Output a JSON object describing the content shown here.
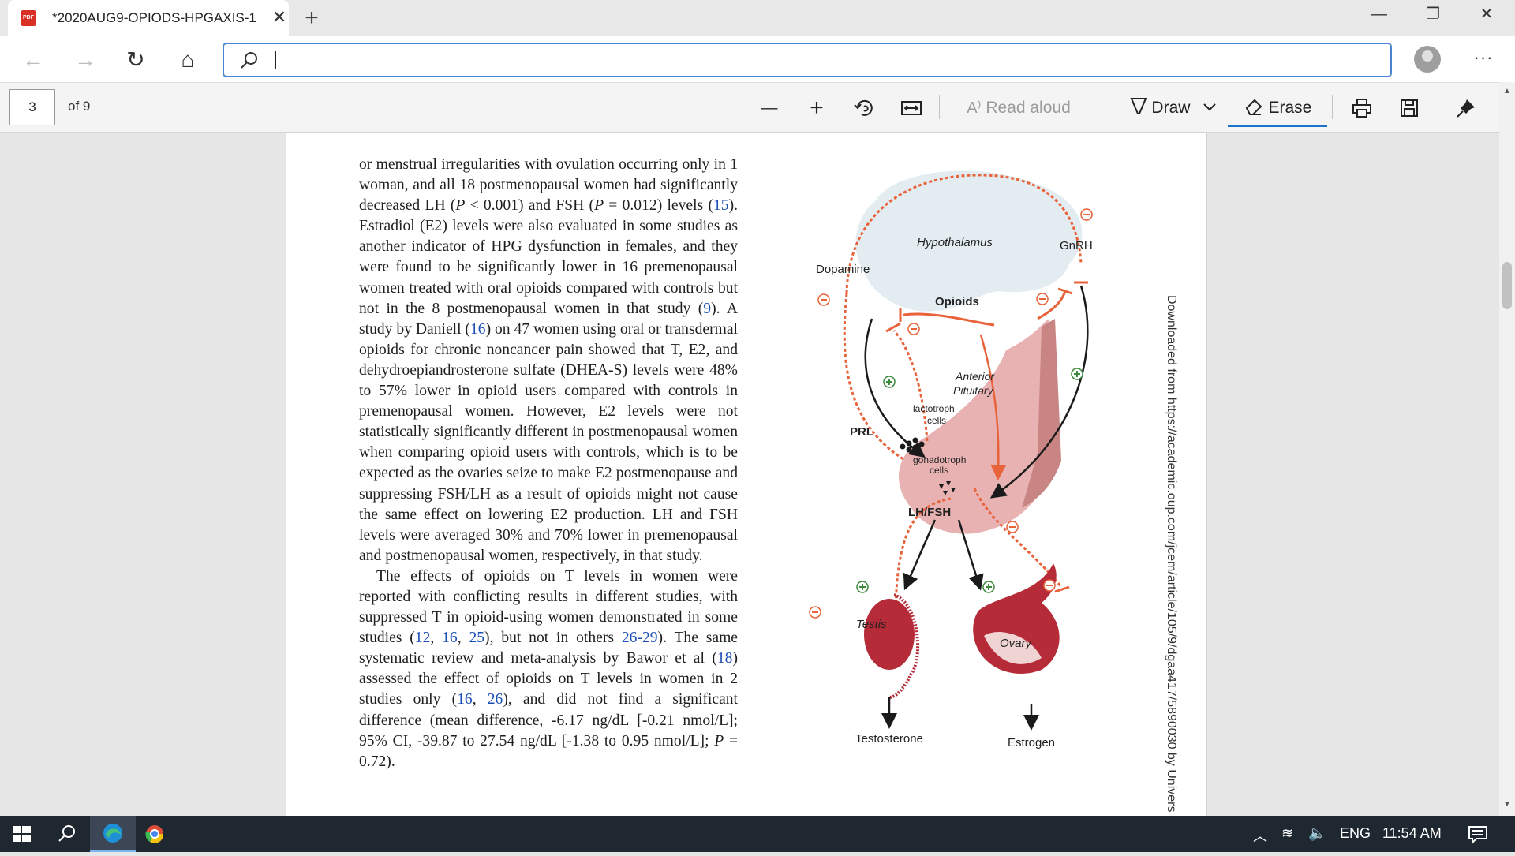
{
  "tab": {
    "title": "*2020AUG9-OPIODS-HPGAXIS-1",
    "close": "✕",
    "new_tab": "+",
    "file_badge": "PDF"
  },
  "window": {
    "minimize": "—",
    "restore": "❐",
    "close": "✕"
  },
  "addressbar": {
    "value": "",
    "placeholder": ""
  },
  "nav": {
    "back": "←",
    "forward": "→",
    "refresh": "↻",
    "home": "⌂",
    "more": "···"
  },
  "pdf_toolbar": {
    "page_number": "3",
    "page_total": "of 9",
    "zoom_out": "—",
    "zoom_in": "+",
    "read_aloud": "Read aloud",
    "draw": "Draw",
    "erase": "Erase"
  },
  "document": {
    "para1": [
      {
        "t": "or menstrual irregularities with ovulation occurring only in 1 woman, and all 18 postmenopausal women had significantly decreased LH ("
      },
      {
        "t": "P",
        "i": true
      },
      {
        "t": " < 0.001) and FSH ("
      },
      {
        "t": "P",
        "i": true
      },
      {
        "t": " = 0.012) levels ("
      },
      {
        "t": "15",
        "r": true
      },
      {
        "t": "). Estradiol (E2) levels were also evaluated in some studies as another indicator of HPG dysfunction in females, and they were found to be significantly lower in 16 premenopausal women treated with oral opioids compared with controls but not in the 8 postmenopausal women in that study ("
      },
      {
        "t": "9",
        "r": true
      },
      {
        "t": "). A study by Daniell ("
      },
      {
        "t": "16",
        "r": true
      },
      {
        "t": ") on 47 women using oral or transdermal opioids for chronic noncancer pain showed that T, E2, and dehydroepiandrosterone sulfate (DHEA-S) levels were 48% to 57% lower in opioid users compared with controls in premenopausal women. However, E2 levels were not statistically significantly different in postmenopausal women when comparing opioid users with controls, which is to be expected as the ovaries seize to make E2 postmenopause and suppressing FSH/LH as a result of opioids might not cause the same effect on lowering E2 production. LH and FSH levels were averaged 30% and 70% lower in premenopausal and postmenopausal women, respectively, in that study."
      }
    ],
    "para2": [
      {
        "t": "The effects of opioids on T levels in women were reported with conflicting results in different studies, with suppressed T in opioid-using women demonstrated in some studies ("
      },
      {
        "t": "12",
        "r": true
      },
      {
        "t": ", "
      },
      {
        "t": "16",
        "r": true
      },
      {
        "t": ", "
      },
      {
        "t": "25",
        "r": true
      },
      {
        "t": "), but not in others "
      },
      {
        "t": "26-29",
        "r": true
      },
      {
        "t": "). The same systematic review and meta-analysis by Bawor et al ("
      },
      {
        "t": "18",
        "r": true
      },
      {
        "t": ") assessed the effect of opioids on T levels in women in 2 studies only ("
      },
      {
        "t": "16",
        "r": true
      },
      {
        "t": ", "
      },
      {
        "t": "26",
        "r": true
      },
      {
        "t": "), and did not find a significant difference (mean difference, -6.17 ng/dL [-0.21 nmol/L]; 95% CI, -39.87 to 27.54 ng/dL [-1.38 to 0.95 nmol/L]; "
      },
      {
        "t": "P",
        "i": true
      },
      {
        "t": " = 0.72)."
      }
    ],
    "watermark": "Downloaded from https://academic.oup.com/jcem/article/105/9/dgaa417/5890030 by Univers"
  },
  "figure": {
    "labels": {
      "hypothalamus": "Hypothalamus",
      "gnrh": "GnRH",
      "dopamine": "Dopamine",
      "opioids": "Opioids",
      "anterior_pituitary": "Anterior\nPituitary",
      "lactotroph": "lactotroph\ncells",
      "prl": "PRL",
      "gonadotroph": "gonadotroph\ncells",
      "lhfsh": "LH/FSH",
      "testis": "Testis",
      "ovary": "Ovary",
      "testosterone": "Testosterone",
      "estrogen": "Estrogen"
    },
    "colors": {
      "inhibitory": "#e8623a",
      "stimulatory": "#1a1a1a",
      "brain": "#e2ecf1",
      "pituitary": "#e9b2b2",
      "organ": "#b52b38"
    }
  },
  "taskbar": {
    "lang": "ENG",
    "time": "11:54 AM"
  }
}
